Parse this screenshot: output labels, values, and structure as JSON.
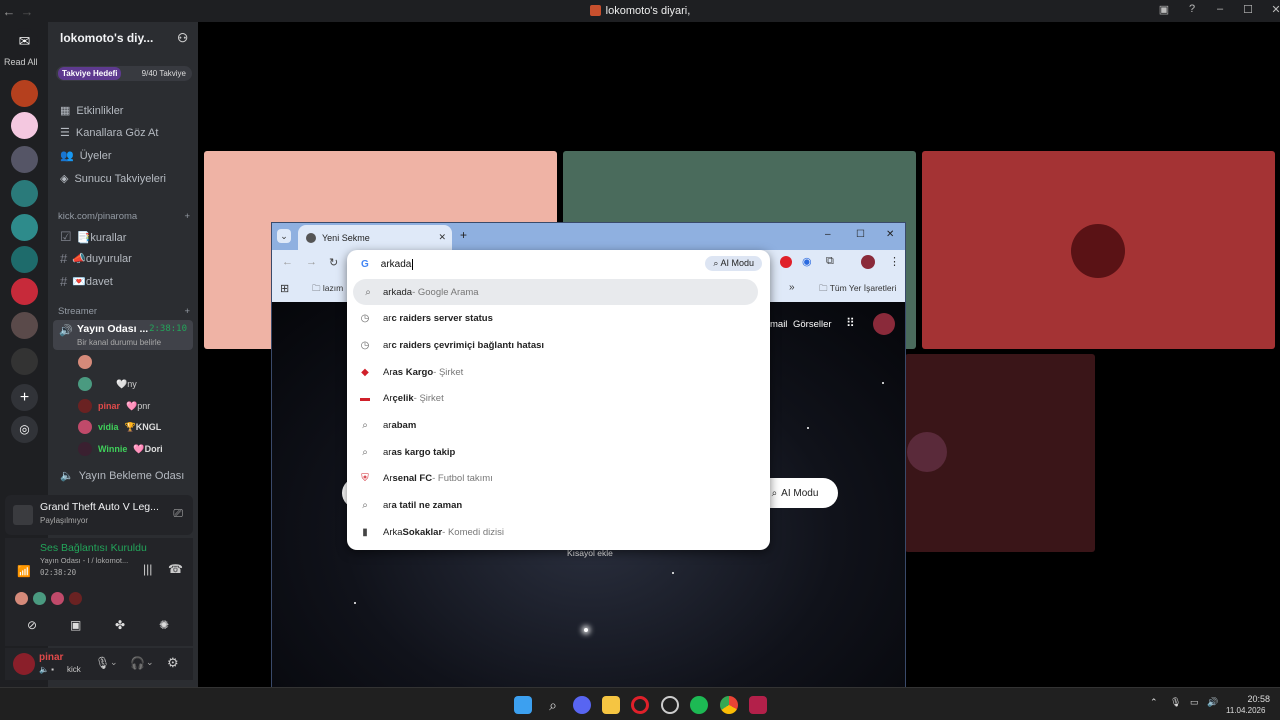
{
  "window": {
    "title": "lokomoto's diyari,"
  },
  "discord": {
    "read_all": "Read All",
    "server_name": "lokomoto's diy...",
    "boost": {
      "label": "Takviye Hedefi",
      "count": "9/40 Takviye"
    },
    "menu": [
      "Etkinlikler",
      "Kanallara Göz At",
      "Üyeler",
      "Sunucu Takviyeleri"
    ],
    "category_kick": "kick.com/pinaroma",
    "text_channels": [
      "📑kurallar",
      "📣duyurular",
      "💌davet"
    ],
    "category_streamer": "Streamer",
    "voice_active": {
      "name": "Yayın Odası ...",
      "time": "2:38:10",
      "status": "Bir kanal durumu belirle"
    },
    "members": [
      {
        "name": "",
        "tag": ""
      },
      {
        "name": "",
        "tag": "🤍ny"
      },
      {
        "name": "pinar",
        "tag": "🩷pnr"
      },
      {
        "name": "vidia",
        "tag": "🏆KNGL"
      },
      {
        "name": "Winnie",
        "tag": "🩷Dori"
      }
    ],
    "voice_waiting": "Yayın Bekleme Odası",
    "hand_category": "✋",
    "game": {
      "title": "Grand Theft Auto V Leg...",
      "sub": "Paylaşılmıyor"
    },
    "voice_status": {
      "title": "Ses Bağlantısı Kuruldu",
      "channel": "Yayın Odası - I / lokomot...",
      "time": "02:38:20"
    },
    "user": {
      "name": "pinar",
      "status": "kick"
    }
  },
  "chrome": {
    "tab_title": "Yeni Sekme",
    "omnibox_value": "arkada",
    "ai_mode": "AI Modu",
    "bookmark_folder": "lazım",
    "all_bookmarks": "Tüm Yer İşaretleri",
    "ntp_links": [
      "mail",
      "Görseller"
    ],
    "ntp_ai_mode": "AI Modu",
    "shortcut_label": "Kısayol ekle",
    "suggestions": [
      {
        "icon": "search-icon",
        "typed": "arkada",
        "rest": "",
        "sub": " - Google Arama"
      },
      {
        "icon": "history-icon",
        "typed": "ar",
        "rest": "c raiders server status",
        "sub": ""
      },
      {
        "icon": "history-icon",
        "typed": "ar",
        "rest": "c raiders çevrimiçi bağlantı hatası",
        "sub": ""
      },
      {
        "icon": "aras-logo-icon",
        "typed": "Ar",
        "rest": "as Kargo",
        "sub": " - Şirket"
      },
      {
        "icon": "arcelik-logo-icon",
        "typed": "Ar",
        "rest": "çelik",
        "sub": " - Şirket"
      },
      {
        "icon": "search-icon",
        "typed": "ar",
        "rest": "abam",
        "sub": ""
      },
      {
        "icon": "search-icon",
        "typed": "ar",
        "rest": "as kargo takip",
        "sub": ""
      },
      {
        "icon": "arsenal-logo-icon",
        "typed": "Ar",
        "rest": "senal FC",
        "sub": " - Futbol takımı"
      },
      {
        "icon": "search-icon",
        "typed": "ar",
        "rest": "a tatil ne zaman",
        "sub": ""
      },
      {
        "icon": "arka-sokaklar-icon",
        "typed": "Arka ",
        "rest": "Sokaklar",
        "sub": " - Komedi dizisi"
      }
    ]
  },
  "taskbar": {
    "time": "20:58",
    "date": "11.04.2026"
  },
  "colors": {
    "tile_pink": "#efb3a5",
    "tile_green": "#4a6b5c",
    "tile_red": "#a43334",
    "tile_darkred": "#3a1518",
    "discord_bg": "#2b2d31",
    "chrome_tab": "#8fb0e0"
  }
}
